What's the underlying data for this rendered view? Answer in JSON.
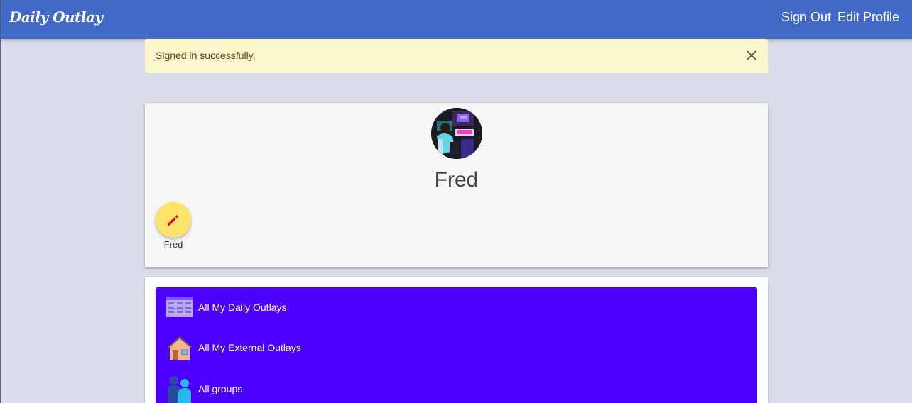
{
  "navbar": {
    "brand": "Daily Outlay",
    "links": {
      "sign_out": "Sign Out",
      "edit_profile": "Edit Profile"
    }
  },
  "alert": {
    "message": "Signed in successfully."
  },
  "profile": {
    "name": "Fred",
    "edit_caption": "Fred"
  },
  "menu": {
    "items": [
      {
        "label": "All My Daily Outlays",
        "icon": "spreadsheet-icon"
      },
      {
        "label": "All My External Outlays",
        "icon": "house-icon"
      },
      {
        "label": "All groups",
        "icon": "people-icon"
      }
    ]
  },
  "colors": {
    "navbar": "#4169c6",
    "page_background": "#d9dcea",
    "alert_background": "#fdf7cc",
    "menu_panel": "#4b00ff",
    "fab": "#fbe46a",
    "fab_icon": "#e01020"
  }
}
